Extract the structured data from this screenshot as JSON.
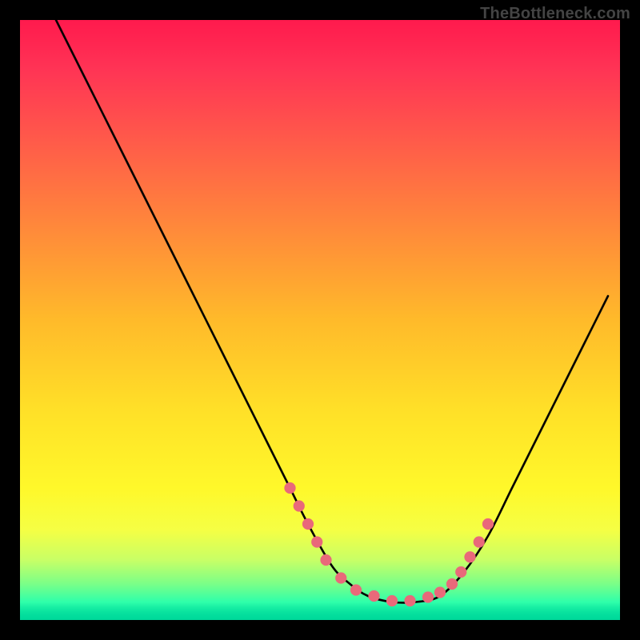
{
  "watermark": "TheBottleneck.com",
  "chart_data": {
    "type": "line",
    "title": "",
    "xlabel": "",
    "ylabel": "",
    "xlim": [
      0,
      100
    ],
    "ylim": [
      0,
      100
    ],
    "grid": false,
    "legend": false,
    "series": [
      {
        "name": "bottleneck-curve",
        "color": "#000000",
        "x": [
          6,
          10,
          15,
          20,
          25,
          30,
          35,
          40,
          45,
          48,
          52,
          55,
          58,
          62,
          66,
          70,
          74,
          78,
          82,
          86,
          90,
          94,
          98
        ],
        "y": [
          100,
          92,
          82,
          72,
          62,
          52,
          42,
          32,
          22,
          16,
          9,
          6,
          4,
          3,
          3,
          4,
          8,
          14,
          22,
          30,
          38,
          46,
          54
        ]
      }
    ],
    "markers": {
      "name": "highlight-points",
      "color": "#e9697a",
      "radius": 7,
      "x": [
        45,
        46.5,
        48,
        49.5,
        51,
        53.5,
        56,
        59,
        62,
        65,
        68,
        70,
        72,
        73.5,
        75,
        76.5,
        78
      ],
      "y": [
        22,
        19,
        16,
        13,
        10,
        7,
        5,
        4,
        3.2,
        3.2,
        3.8,
        4.6,
        6,
        8,
        10.5,
        13,
        16
      ]
    },
    "background_gradient": {
      "top": "#ff1a4d",
      "mid": "#ffe028",
      "bottom": "#00d89a"
    }
  }
}
